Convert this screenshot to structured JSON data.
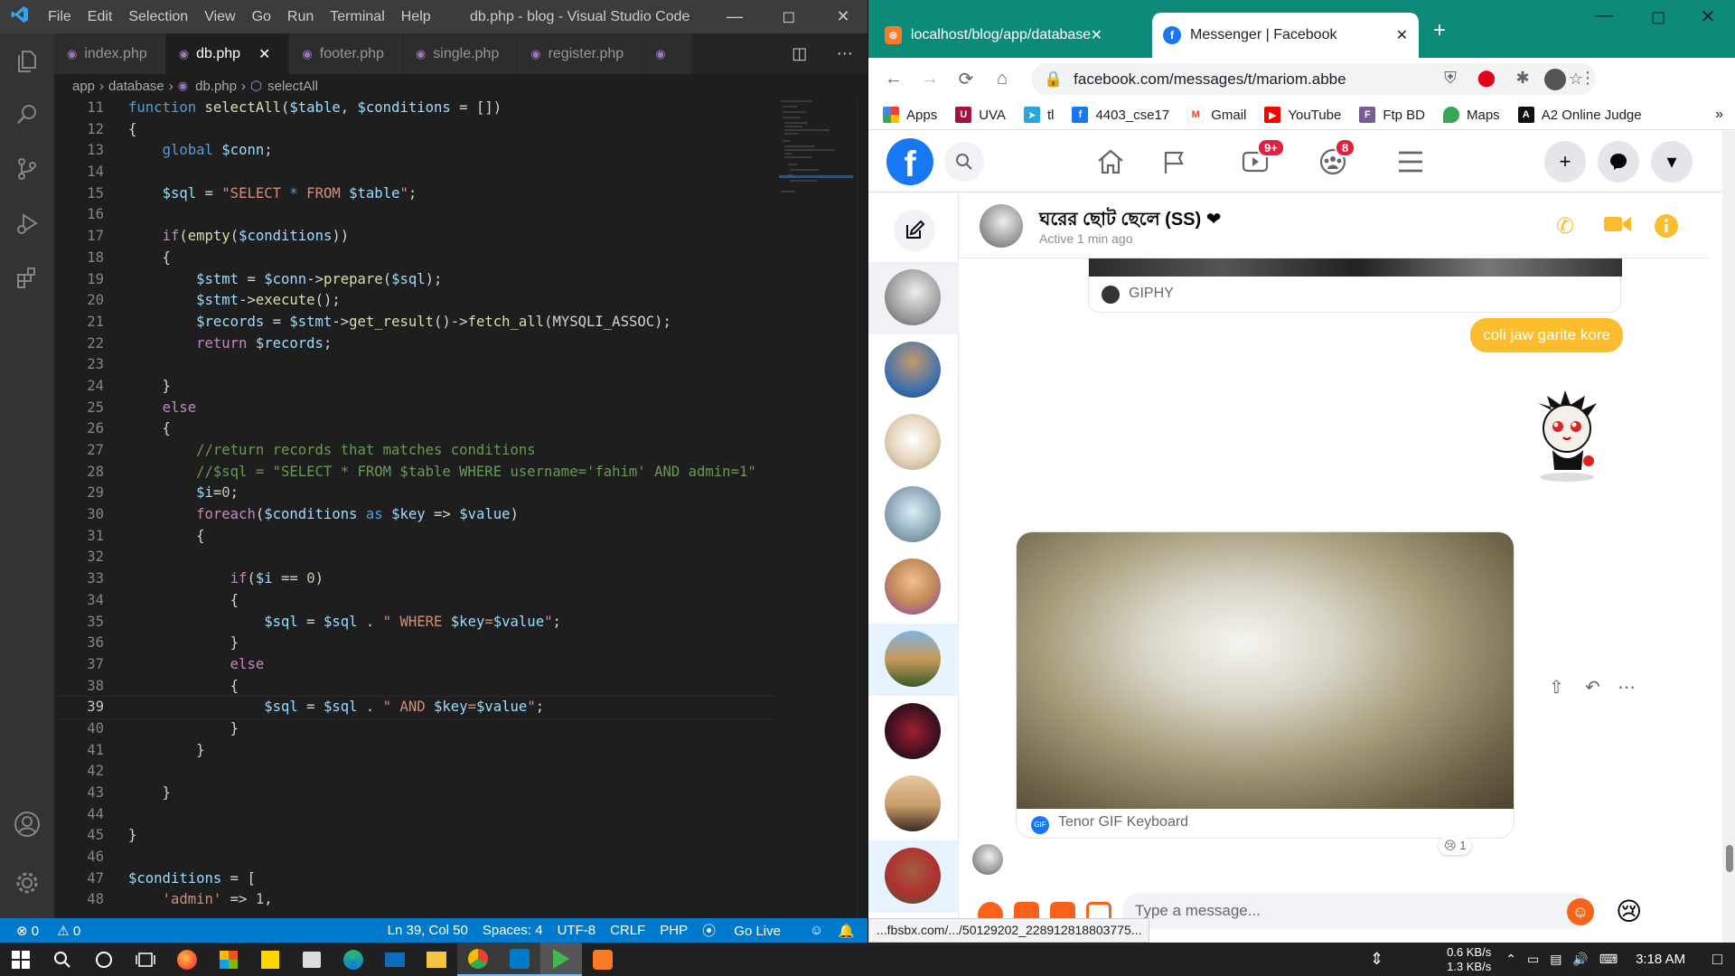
{
  "vscode": {
    "menu": [
      "File",
      "Edit",
      "Selection",
      "View",
      "Go",
      "Run",
      "Terminal",
      "Help"
    ],
    "window_title": "db.php - blog - Visual Studio Code",
    "tabs": [
      {
        "label": "index.php"
      },
      {
        "label": "db.php"
      },
      {
        "label": "footer.php"
      },
      {
        "label": "single.php"
      },
      {
        "label": "register.php"
      }
    ],
    "breadcrumb": {
      "p1": "app",
      "p2": "database",
      "p3": "db.php",
      "p4": "selectAll"
    },
    "code_lines": [
      {
        "n": "11",
        "html": "<span class='kw'>function</span> <span class='fn'>selectAll</span>(<span class='var'>$table</span>, <span class='var'>$conditions</span> = [])"
      },
      {
        "n": "12",
        "html": "{"
      },
      {
        "n": "13",
        "html": "    <span class='kw'>global</span> <span class='var'>$conn</span>;"
      },
      {
        "n": "14",
        "html": ""
      },
      {
        "n": "15",
        "html": "    <span class='var'>$sql</span> = <span class='str'>\"SELECT </span><span class='kw'>*</span><span class='str'> FROM </span><span class='var'>$table</span><span class='str'>\"</span>;"
      },
      {
        "n": "16",
        "html": ""
      },
      {
        "n": "17",
        "html": "    <span class='ctl'>if</span>(<span class='fn'>empty</span>(<span class='var'>$conditions</span>))"
      },
      {
        "n": "18",
        "html": "    {"
      },
      {
        "n": "19",
        "html": "        <span class='var'>$stmt</span> = <span class='var'>$conn</span>-><span class='fn'>prepare</span>(<span class='var'>$sql</span>);"
      },
      {
        "n": "20",
        "html": "        <span class='var'>$stmt</span>-><span class='fn'>execute</span>();"
      },
      {
        "n": "21",
        "html": "        <span class='var'>$records</span> = <span class='var'>$stmt</span>-><span class='fn'>get_result</span>()-><span class='fn'>fetch_all</span>(MYSQLI_ASSOC);"
      },
      {
        "n": "22",
        "html": "        <span class='ctl'>return</span> <span class='var'>$records</span>;"
      },
      {
        "n": "23",
        "html": ""
      },
      {
        "n": "24",
        "html": "    }"
      },
      {
        "n": "25",
        "html": "    <span class='ctl'>else</span>"
      },
      {
        "n": "26",
        "html": "    {"
      },
      {
        "n": "27",
        "html": "        <span class='cm'>//return records that matches conditions</span>"
      },
      {
        "n": "28",
        "html": "        <span class='cm'>//$sql = \"SELECT * FROM $table WHERE username='fahim' AND admin=1\"</span>"
      },
      {
        "n": "29",
        "html": "        <span class='var'>$i</span>=<span class='num'>0</span>;"
      },
      {
        "n": "30",
        "html": "        <span class='ctl'>foreach</span>(<span class='var'>$conditions</span> <span class='kw'>as</span> <span class='var'>$key</span> => <span class='var'>$value</span>)"
      },
      {
        "n": "31",
        "html": "        {"
      },
      {
        "n": "32",
        "html": ""
      },
      {
        "n": "33",
        "html": "            <span class='ctl'>if</span>(<span class='var'>$i</span> == <span class='num'>0</span>)"
      },
      {
        "n": "34",
        "html": "            {"
      },
      {
        "n": "35",
        "html": "                <span class='var'>$sql</span> = <span class='var'>$sql</span> . <span class='str'>\" WHERE </span><span class='var'>$key</span><span class='str'>=</span><span class='var'>$value</span><span class='str'>\"</span>;"
      },
      {
        "n": "36",
        "html": "            }"
      },
      {
        "n": "37",
        "html": "            <span class='ctl'>else</span>"
      },
      {
        "n": "38",
        "html": "            {"
      },
      {
        "n": "39",
        "html": "                <span class='var'>$sql</span> = <span class='var'>$sql</span> . <span class='str'>\" AND </span><span class='var'>$key</span><span class='str'>=</span><span class='var'>$value</span><span class='str'>\"</span>;"
      },
      {
        "n": "40",
        "html": "            }"
      },
      {
        "n": "41",
        "html": "        }"
      },
      {
        "n": "42",
        "html": ""
      },
      {
        "n": "43",
        "html": "    }"
      },
      {
        "n": "44",
        "html": ""
      },
      {
        "n": "45",
        "html": "}"
      },
      {
        "n": "46",
        "html": ""
      },
      {
        "n": "47",
        "html": "<span class='var'>$conditions</span> = ["
      },
      {
        "n": "48",
        "html": "    <span class='str'>'admin'</span> => <span class='num'>1</span>,"
      }
    ],
    "current_line": "39",
    "status": {
      "errors": "0",
      "warnings": "0",
      "position": "Ln 39, Col 50",
      "spaces": "Spaces: 4",
      "encoding": "UTF-8",
      "eol": "CRLF",
      "language": "PHP",
      "golive": "Go Live"
    }
  },
  "chrome": {
    "tabs": [
      {
        "title": "localhost/blog/app/database/db"
      },
      {
        "title": "Messenger | Facebook"
      }
    ],
    "url": "facebook.com/messages/t/mariom.abbe",
    "bookmarks": [
      {
        "label": "Apps",
        "icon": "apps-grid-icon",
        "color": "#ea4335"
      },
      {
        "label": "UVA",
        "icon": "uva-icon",
        "color": "#a4133c"
      },
      {
        "label": "tl",
        "icon": "tl-icon",
        "color": "#2ba5e0"
      },
      {
        "label": "4403_cse17",
        "icon": "facebook-icon",
        "color": "#1877f2"
      },
      {
        "label": "Gmail",
        "icon": "gmail-icon",
        "color": "#ea4335"
      },
      {
        "label": "YouTube",
        "icon": "youtube-icon",
        "color": "#ff0000"
      },
      {
        "label": "Ftp BD",
        "icon": "ftpbd-icon",
        "color": "#7a5c99"
      },
      {
        "label": "Maps",
        "icon": "maps-icon",
        "color": "#34a853"
      },
      {
        "label": "A2 Online Judge",
        "icon": "a2-icon",
        "color": "#111111"
      }
    ],
    "status_url": "...fbsbx.com/.../50129202_228912818803775..."
  },
  "facebook": {
    "badges": {
      "watch": "9+",
      "groups": "8"
    },
    "conversation": {
      "name": "ঘরের ছোট ছেলে (SS) ❤",
      "status": "Active 1 min ago"
    },
    "messages": {
      "giphy_label": "GIPHY",
      "bubble_text": "coli jaw garite kore",
      "tenor_label": "Tenor GIF Keyboard",
      "reaction_count": "1"
    },
    "input_placeholder": "Type a message...",
    "accent": "#1877f2",
    "bubble_color": "#fbbd2e"
  },
  "taskbar": {
    "net_up": "0.6 KB/s",
    "net_down": "1.3 KB/s",
    "time": "3:18 AM"
  }
}
